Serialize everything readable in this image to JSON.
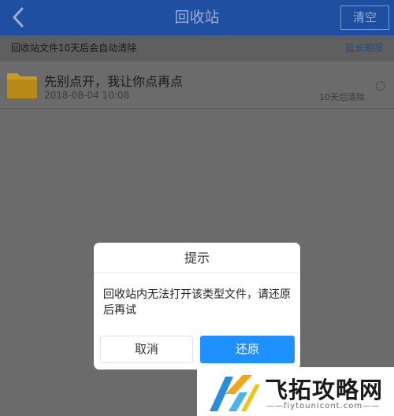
{
  "header": {
    "back_icon": "chevron-left-icon",
    "title": "回收站",
    "clear_label": "清空"
  },
  "notice": {
    "text": "回收站文件10天后会自动清除",
    "extend_link": "延长期限"
  },
  "files": [
    {
      "icon": "folder-icon",
      "name": "先别点开，我让你点再点",
      "date": "2018-08-04  10:08",
      "expire": "10天后清除",
      "selected": false
    }
  ],
  "dialog": {
    "title": "提示",
    "message": "回收站内无法打开该类型文件，请还原后再试",
    "cancel_label": "取消",
    "restore_label": "还原"
  },
  "watermark": {
    "text": "飞拓攻略网",
    "url": "——fiytounicont.com——"
  },
  "colors": {
    "header": "#1f4fa0",
    "primary_button": "#1f90ff",
    "overlay": "#6b6b6b",
    "folder": "#c99a1e"
  }
}
